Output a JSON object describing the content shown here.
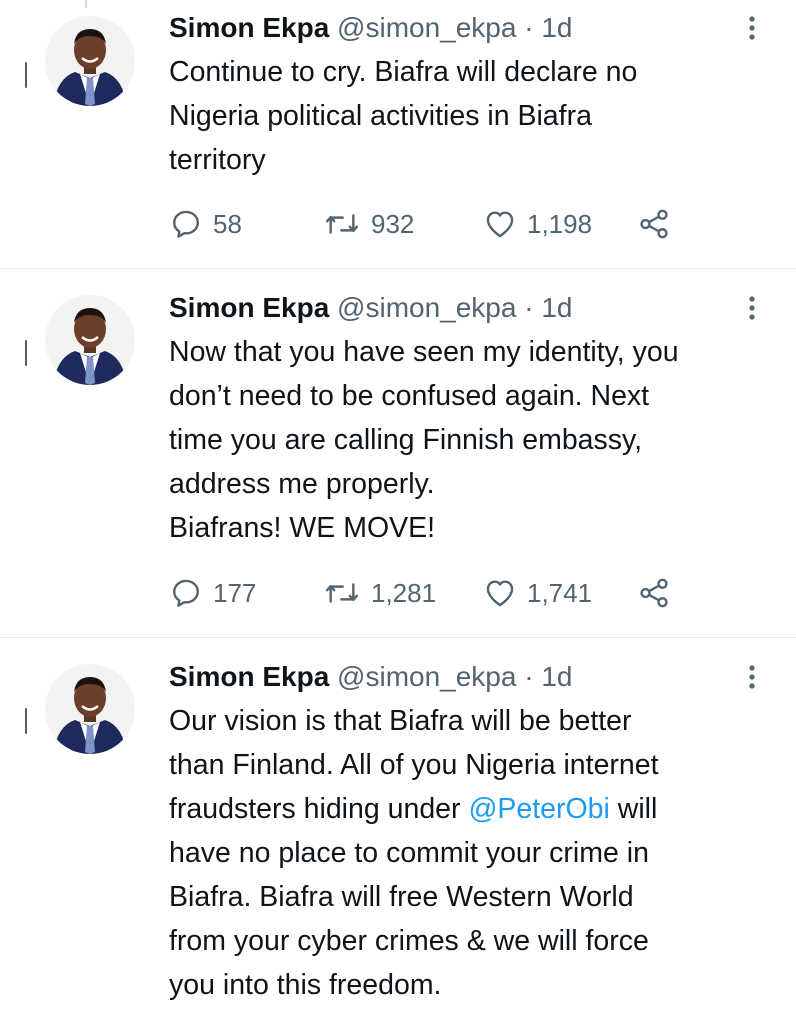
{
  "tweets": [
    {
      "author_name": "Simon Ekpa",
      "handle": "@simon_ekpa",
      "separator": "·",
      "time": "1d",
      "text_lines": [
        "Continue to cry. Biafra will declare no",
        "Nigeria political activities in Biafra",
        "territory"
      ],
      "replies": "58",
      "retweets": "932",
      "likes": "1,198"
    },
    {
      "author_name": "Simon Ekpa",
      "handle": "@simon_ekpa",
      "separator": "·",
      "time": "1d",
      "text_lines": [
        "Now that you have seen my identity, you",
        "don’t need to be confused again. Next",
        "time you are calling Finnish embassy,",
        "address me properly.",
        "Biafrans! WE MOVE!"
      ],
      "replies": "177",
      "retweets": "1,281",
      "likes": "1,741"
    },
    {
      "author_name": "Simon Ekpa",
      "handle": "@simon_ekpa",
      "separator": "·",
      "time": "1d",
      "text_lines": [
        "Our vision is that Biafra will be better",
        "than Finland. All of you Nigeria internet",
        "fraudsters hiding under ",
        "have no place to commit your crime in",
        "Biafra. Biafra will free Western World",
        "from your cyber crimes & we will force",
        "you into this freedom."
      ],
      "mention": "@PeterObi",
      "mention_after": " will"
    }
  ],
  "icons": {
    "reply": "reply-icon",
    "retweet": "retweet-icon",
    "like": "heart-icon",
    "share": "share-icon",
    "more": "more-vertical-icon",
    "avatar": "avatar"
  },
  "colors": {
    "text": "#0f1419",
    "secondary": "#536471",
    "link": "#1d9bf0",
    "divider": "#e4e8eb"
  }
}
